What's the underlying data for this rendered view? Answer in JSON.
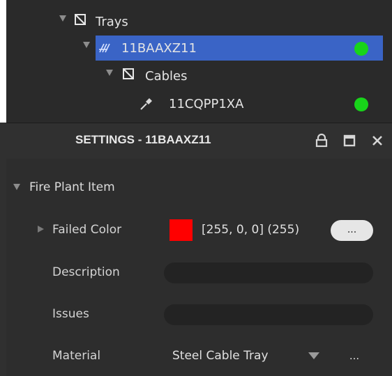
{
  "tree": {
    "items": [
      {
        "label": "Trays",
        "icon": "folder-icon",
        "selected": false,
        "status_color": null
      },
      {
        "label": "11BAAXZ11",
        "icon": "cable-tray-icon",
        "selected": true,
        "status_color": "#18d41a"
      },
      {
        "label": "Cables",
        "icon": "folder-icon",
        "selected": false,
        "status_color": null
      },
      {
        "label": "11CQPP1XA",
        "icon": "cable-icon",
        "selected": false,
        "status_color": "#18d41a"
      }
    ]
  },
  "settings": {
    "title": "SETTINGS - 11BAAXZ11",
    "header_buttons": [
      "lock-icon",
      "maximize-icon",
      "close-icon"
    ],
    "section": {
      "label": "Fire Plant Item",
      "properties": {
        "failed_color": {
          "label": "Failed Color",
          "swatch": "#ff0000",
          "value": "[255, 0, 0] (255)",
          "button_label": "..."
        },
        "description": {
          "label": "Description",
          "value": ""
        },
        "issues": {
          "label": "Issues",
          "value": ""
        },
        "material": {
          "label": "Material",
          "value": "Steel Cable Tray",
          "more_label": "..."
        }
      }
    }
  },
  "colors": {
    "selection": "#3a64c6",
    "panel": "#2d2d2d",
    "status_ok": "#18d41a"
  }
}
